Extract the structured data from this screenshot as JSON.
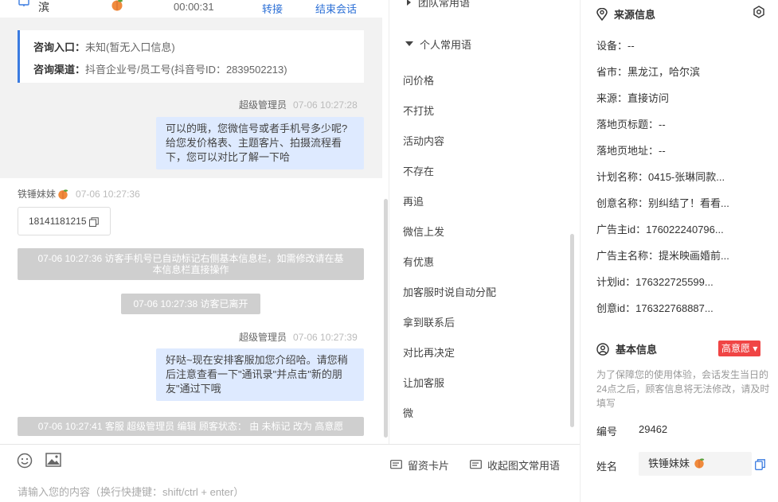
{
  "header": {
    "location_fragment": "滨",
    "timer": "00:00:31",
    "transfer_label": "转接",
    "end_label": "结束会话"
  },
  "consult_info": {
    "entry_label": "咨询入口：",
    "entry_value": "未知(暂无入口信息)",
    "channel_label": "咨询渠道：",
    "channel_value": "抖音企业号/员工号(抖音号ID：2839502213)"
  },
  "messages": {
    "m1_sender": "超级管理员",
    "m1_time": "07-06 10:27:28",
    "m1_lines": [
      "可以的哦，您微信号或者手机号多少呢?",
      "给您发价格表、主题客片、拍摄流程看",
      "下，您可以对比了解一下哈"
    ],
    "m2_sender": "铁锤妹妹",
    "m2_time": "07-06 10:27:36",
    "m2_phone": "18141181215",
    "sys1_lines": [
      "07-06 10:27:36 访客手机号已自动标记右侧基本信息栏，如需修改请在基",
      "本信息栏直接操作"
    ],
    "sys2": "07-06 10:27:38 访客已离开",
    "m3_sender": "超级管理员",
    "m3_time": "07-06 10:27:39",
    "m3_lines": [
      "好哒~现在安排客服加您介绍哈。请您稍",
      "后注意查看一下\"通讯录\"并点击\"新的朋",
      "友\"通过下哦"
    ],
    "sys3": "07-06 10:27:41 客服 超级管理员 编辑 顾客状态： 由 未标记 改为 高意愿"
  },
  "input": {
    "placeholder": "请输入您的内容（换行快捷键：shift/ctrl + enter）",
    "card_label": "留资卡片",
    "collapse_label": "收起图文常用语"
  },
  "phrases": {
    "team_group": "团队常用语",
    "personal_group": "个人常用语",
    "items": [
      "问价格",
      "不打扰",
      "活动内容",
      "不存在",
      "再追",
      "微信上发",
      "有优惠",
      "加客服时说自动分配",
      "拿到联系后",
      "对比再决定",
      "让加客服",
      "微"
    ]
  },
  "source_info": {
    "title": "来源信息",
    "rows": [
      "设备：--",
      "省市：黑龙江，哈尔滨",
      "来源：直接访问",
      "落地页标题：--",
      "落地页地址：--",
      "计划名称：0415-张琳同款...",
      "创意名称：别纠结了！看看...",
      "广告主id：176022240796...",
      "广告主名称：提米映画婚前...",
      "计划id：176322725599...",
      "创意id：176322768887..."
    ]
  },
  "basic_info": {
    "title": "基本信息",
    "intent_tag": "高意愿 ▾",
    "notice": "为了保障您的使用体验，会话发生当日的24点之后，顾客信息将无法修改，请及时填写",
    "id_label": "编号",
    "id_value": "29462",
    "name_label": "姓名",
    "name_value": "铁锤妹妹"
  },
  "colors": {
    "accent": "#3a7be0",
    "bubble": "#deeaff",
    "tag_red": "#f04545",
    "peach": "#f08a3c"
  }
}
